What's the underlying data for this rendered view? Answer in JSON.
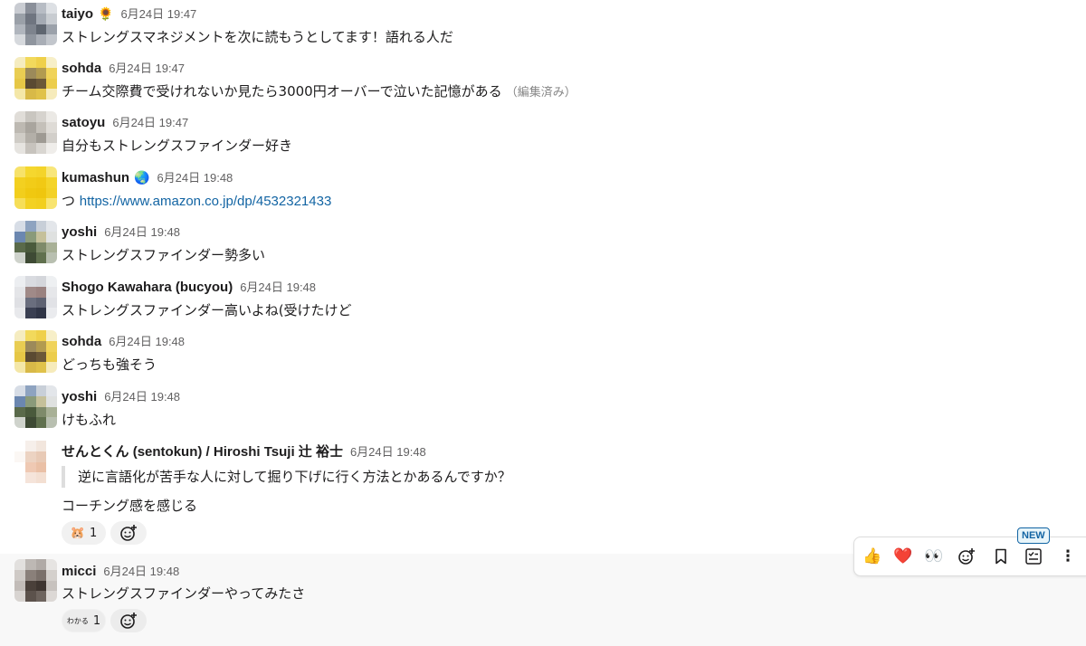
{
  "messages": [
    {
      "name": "taiyo",
      "emoji": "🌻",
      "time": "6月24日 19:47",
      "text": "ストレングスマネジメントを次に読もうとしてます！語れる人だ"
    },
    {
      "name": "sohda",
      "time": "6月24日 19:47",
      "text": "チーム交際費で受けれないか見たら3000円オーバーで泣いた記憶がある",
      "edited": "（編集済み）"
    },
    {
      "name": "satoyu",
      "time": "6月24日 19:47",
      "text": "自分もストレングスファインダー好き"
    },
    {
      "name": "kumashun",
      "emoji": "🌏",
      "time": "6月24日 19:48",
      "text_prefix": "つ ",
      "link": "https://www.amazon.co.jp/dp/4532321433"
    },
    {
      "name": "yoshi",
      "time": "6月24日 19:48",
      "text": "ストレングスファインダー勢多い"
    },
    {
      "name": "Shogo Kawahara (bucyou)",
      "time": "6月24日 19:48",
      "text": "ストレングスファインダー高いよね(受けたけど"
    },
    {
      "name": "sohda",
      "time": "6月24日 19:48",
      "text": "どっちも強そう"
    },
    {
      "name": "yoshi",
      "time": "6月24日 19:48",
      "text": "けもふれ"
    },
    {
      "name": "せんとくん (sentokun) / Hiroshi Tsuji 辻 裕士",
      "time": "6月24日 19:48",
      "quote": "逆に言語化が苦手な人に対して掘り下げに行く方法とかあるんですか？",
      "text": "コーチング感を感じる",
      "reaction": {
        "emoji": "🐹",
        "count": "1"
      }
    },
    {
      "name": "micci",
      "time": "6月24日 19:48",
      "text": "ストレングスファインダーやってみたさ",
      "reaction": {
        "emoji": "わかる",
        "count": "1"
      }
    }
  ],
  "toolbar": {
    "new_badge": "NEW",
    "items": [
      "thumbs-up",
      "heart",
      "eyes",
      "add-reaction",
      "bookmark",
      "add-to-list",
      "more"
    ],
    "emoji_thumbs": "👍",
    "emoji_heart": "❤️",
    "emoji_eyes": "👀",
    "more": "⋮"
  },
  "colors": {
    "link": "#1264a3",
    "hover_bg": "#f8f8f8",
    "time": "#616061"
  }
}
